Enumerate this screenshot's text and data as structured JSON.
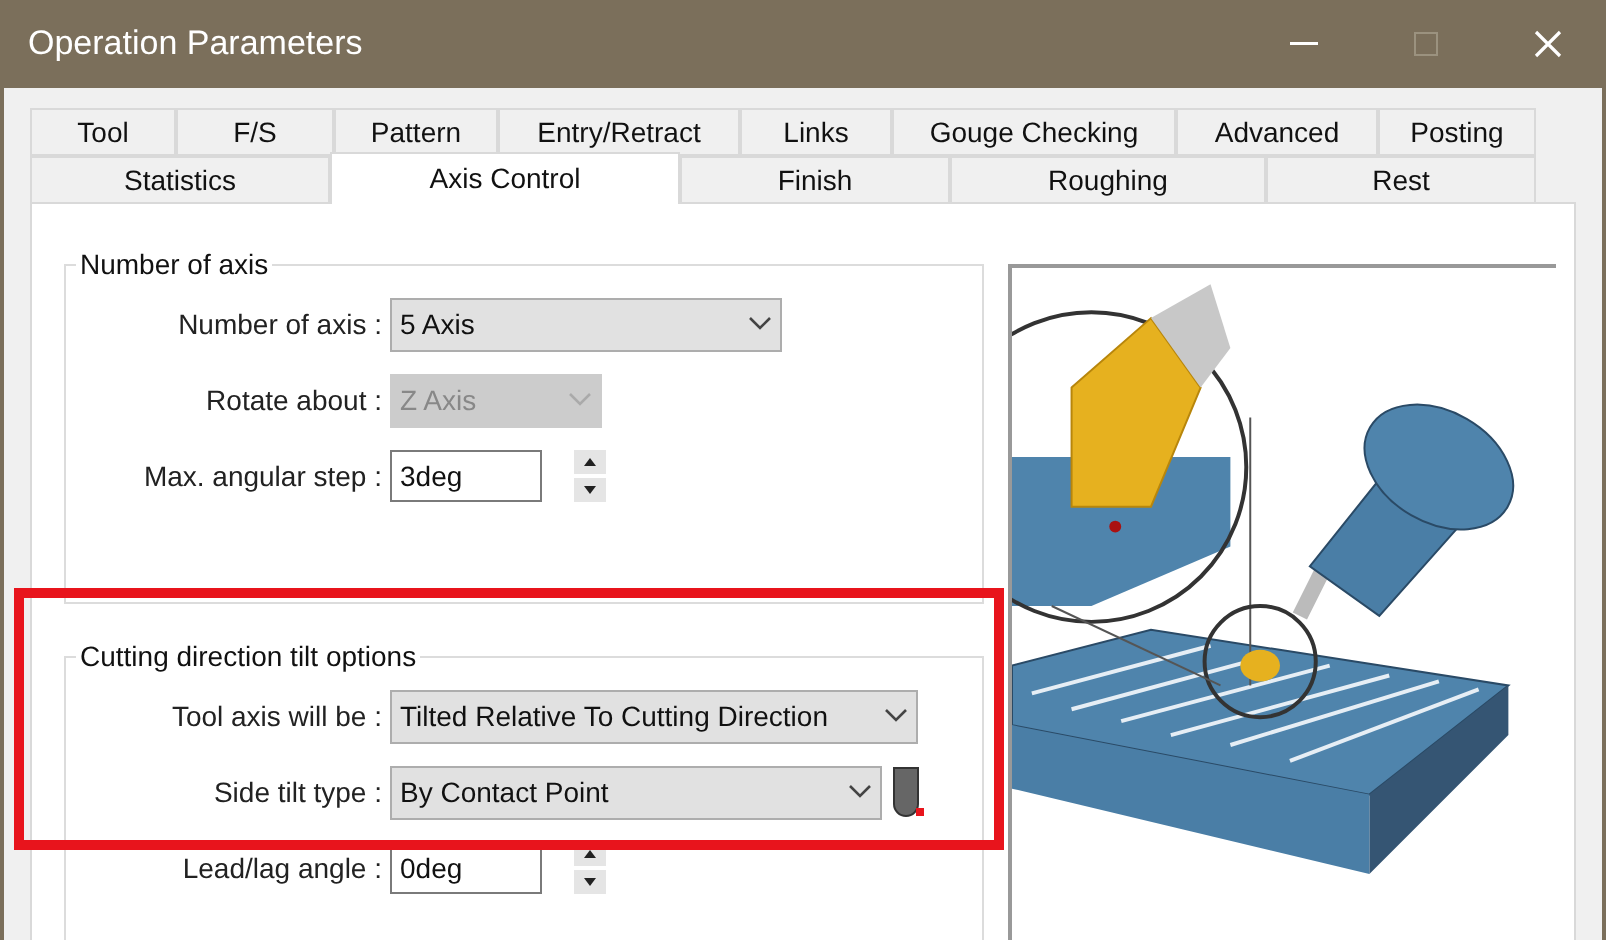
{
  "window": {
    "title": "Operation Parameters"
  },
  "tab_rows": [
    [
      {
        "label": "Tool",
        "selected": false
      },
      {
        "label": "F/S",
        "selected": false
      },
      {
        "label": "Pattern",
        "selected": false
      },
      {
        "label": "Entry/Retract",
        "selected": false
      },
      {
        "label": "Links",
        "selected": false
      },
      {
        "label": "Gouge Checking",
        "selected": false
      },
      {
        "label": "Advanced",
        "selected": false
      },
      {
        "label": "Posting",
        "selected": false
      }
    ],
    [
      {
        "label": "Statistics",
        "selected": false
      },
      {
        "label": "Axis Control",
        "selected": true
      },
      {
        "label": "Finish",
        "selected": false
      },
      {
        "label": "Roughing",
        "selected": false
      },
      {
        "label": "Rest",
        "selected": false
      }
    ]
  ],
  "groups": [
    {
      "title": "Number of axis",
      "highlighted": false,
      "fields": [
        {
          "kind": "combo",
          "label": "Number of axis :",
          "value": "5 Axis",
          "disabled": false
        },
        {
          "kind": "combo",
          "label": "Rotate about :",
          "value": "Z Axis",
          "disabled": true
        },
        {
          "kind": "spin",
          "label": "Max. angular step :",
          "value": "3deg",
          "disabled": false
        }
      ]
    },
    {
      "title": "Cutting direction tilt options",
      "highlighted": true,
      "fields": [
        {
          "kind": "combo",
          "label": "Tool axis will be :",
          "value": "Tilted Relative To Cutting Direction",
          "disabled": false
        },
        {
          "kind": "combo",
          "label": "Side tilt type :",
          "value": "By Contact Point",
          "disabled": false,
          "tool_icon": true
        },
        {
          "kind": "spin",
          "label": "Lead/lag angle :",
          "value": "0deg",
          "disabled": false
        }
      ]
    }
  ]
}
